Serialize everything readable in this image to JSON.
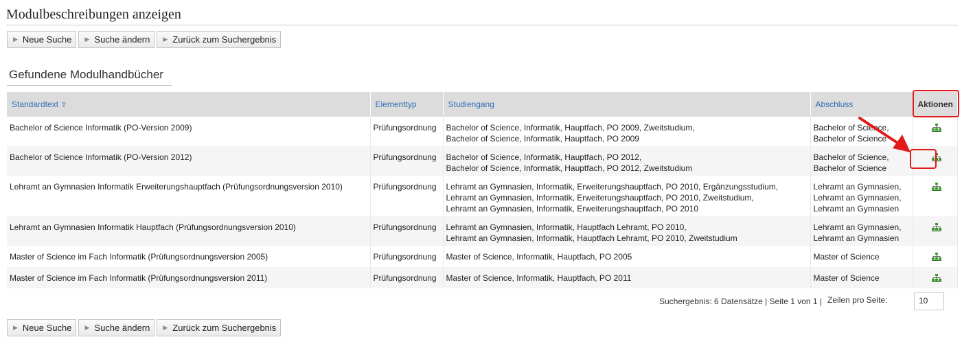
{
  "page": {
    "title": "Modulbeschreibungen anzeigen"
  },
  "buttons": {
    "new_search": "Neue Suche",
    "change_search": "Suche ändern",
    "back_to_results": "Zurück zum Suchergebnis"
  },
  "section": {
    "title": "Gefundene Modulhandbücher"
  },
  "table": {
    "headers": {
      "standardtext": "Standardtext",
      "sort_indicator": "⇧",
      "elementtyp": "Elementtyp",
      "studiengang": "Studiengang",
      "abschluss": "Abschluss",
      "aktionen": "Aktionen"
    },
    "rows": [
      {
        "standardtext": "Bachelor of Science Informatik (PO-Version 2009)",
        "elementtyp": "Prüfungsordnung",
        "studiengang": [
          "Bachelor of Science, Informatik, Hauptfach, PO 2009, Zweitstudium,",
          "Bachelor of Science, Informatik, Hauptfach, PO 2009"
        ],
        "abschluss": [
          "Bachelor of Science,",
          "Bachelor of Science"
        ]
      },
      {
        "standardtext": "Bachelor of Science Informatik (PO-Version 2012)",
        "elementtyp": "Prüfungsordnung",
        "studiengang": [
          "Bachelor of Science, Informatik, Hauptfach, PO 2012,",
          "Bachelor of Science, Informatik, Hauptfach, PO 2012, Zweitstudium"
        ],
        "abschluss": [
          "Bachelor of Science,",
          "Bachelor of Science"
        ]
      },
      {
        "standardtext": "Lehramt an Gymnasien Informatik Erweiterungshauptfach (Prüfungsordnungsversion 2010)",
        "elementtyp": "Prüfungsordnung",
        "studiengang": [
          "Lehramt an Gymnasien, Informatik, Erweiterungshauptfach, PO 2010, Ergänzungsstudium,",
          "Lehramt an Gymnasien, Informatik, Erweiterungshauptfach, PO 2010, Zweitstudium,",
          "Lehramt an Gymnasien, Informatik, Erweiterungshauptfach, PO 2010"
        ],
        "abschluss": [
          "Lehramt an Gymnasien,",
          "Lehramt an Gymnasien,",
          "Lehramt an Gymnasien"
        ]
      },
      {
        "standardtext": "Lehramt an Gymnasien Informatik Hauptfach (Prüfungsordnungsversion 2010)",
        "elementtyp": "Prüfungsordnung",
        "studiengang": [
          "Lehramt an Gymnasien, Informatik, Hauptfach Lehramt, PO 2010,",
          "Lehramt an Gymnasien, Informatik, Hauptfach Lehramt, PO 2010, Zweitstudium"
        ],
        "abschluss": [
          "Lehramt an Gymnasien,",
          "Lehramt an Gymnasien"
        ]
      },
      {
        "standardtext": "Master of Science im Fach Informatik (Prüfungsordnungsversion 2005)",
        "elementtyp": "Prüfungsordnung",
        "studiengang": [
          "Master of Science, Informatik, Hauptfach, PO 2005"
        ],
        "abschluss": [
          "Master of Science"
        ]
      },
      {
        "standardtext": "Master of Science im Fach Informatik (Prüfungsordnungsversion 2011)",
        "elementtyp": "Prüfungsordnung",
        "studiengang": [
          "Master of Science, Informatik, Hauptfach, PO 2011"
        ],
        "abschluss": [
          "Master of Science"
        ]
      }
    ]
  },
  "pagination": {
    "summary": "Suchergebnis: 6 Datensätze | Seite 1 von 1 |",
    "rows_per_page_label": "Zeilen pro Seite:",
    "rows_per_page_value": "10"
  },
  "colors": {
    "accent_link": "#2f6db4",
    "highlight": "#e21a1a",
    "icon_green": "#3a9a2a"
  },
  "icons": {
    "row_action": "module-tree-icon",
    "sort": "sort-up-icon"
  }
}
